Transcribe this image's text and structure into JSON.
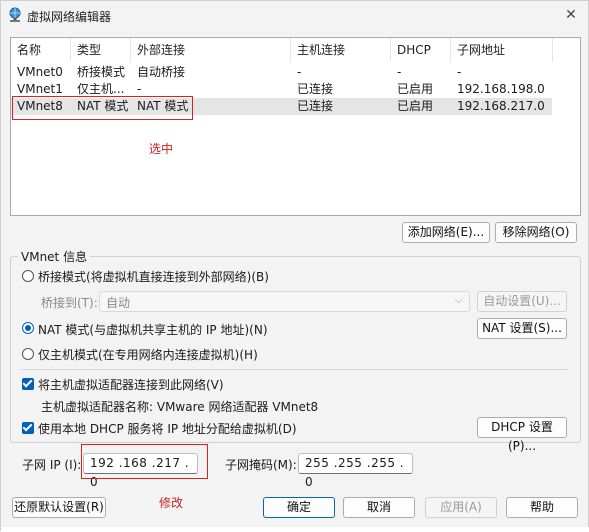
{
  "window": {
    "title": "虚拟网络编辑器",
    "close_glyph": "✕"
  },
  "network_list": {
    "columns": [
      "名称",
      "类型",
      "外部连接",
      "主机连接",
      "DHCP",
      "子网地址"
    ],
    "rows": [
      {
        "name": "VMnet0",
        "type": "桥接模式",
        "external": "自动桥接",
        "host": "-",
        "dhcp": "-",
        "subnet": "-"
      },
      {
        "name": "VMnet1",
        "type": "仅主机...",
        "external": "-",
        "host": "已连接",
        "dhcp": "已启用",
        "subnet": "192.168.198.0"
      },
      {
        "name": "VMnet8",
        "type": "NAT 模式",
        "external": "NAT 模式",
        "host": "已连接",
        "dhcp": "已启用",
        "subnet": "192.168.217.0"
      }
    ],
    "selected_index": 2
  },
  "annotations": {
    "selected_note": "选中",
    "modify_note": "修改",
    "color": "#d21f1f"
  },
  "list_buttons": {
    "add": "添加网络(E)...",
    "remove": "移除网络(O)"
  },
  "vmnet_info": {
    "group_label": "VMnet 信息",
    "bridged_radio": "桥接模式(将虚拟机直接连接到外部网络)(B)",
    "bridged_to_label": "桥接到(T):",
    "bridged_to_value": "自动",
    "auto_settings_button": "自动设置(U)...",
    "nat_radio": "NAT 模式(与虚拟机共享主机的 IP 地址)(N)",
    "nat_settings_button": "NAT 设置(S)...",
    "hostonly_radio": "仅主机模式(在专用网络内连接虚拟机)(H)",
    "connect_adapter_checkbox": "将主机虚拟适配器连接到此网络(V)",
    "adapter_name_label": "主机虚拟适配器名称: VMware 网络适配器 VMnet8",
    "dhcp_checkbox": "使用本地 DHCP 服务将 IP 地址分配给虚拟机(D)",
    "dhcp_settings_button": "DHCP 设置(P)...",
    "selected_mode": "nat",
    "connect_adapter_checked": true,
    "dhcp_checked": true
  },
  "subnet": {
    "ip_label": "子网 IP (I):",
    "ip_value": "192 .168 .217 . 0",
    "mask_label": "子网掩码(M):",
    "mask_value": "255 .255 .255 . 0"
  },
  "footer_buttons": {
    "restore_defaults": "还原默认设置(R)",
    "ok": "确定",
    "cancel": "取消",
    "apply": "应用(A)",
    "help": "帮助"
  },
  "colors": {
    "accent": "#005fb8",
    "annotation_red": "#e02020",
    "selected_row": "#e5e5e5"
  }
}
